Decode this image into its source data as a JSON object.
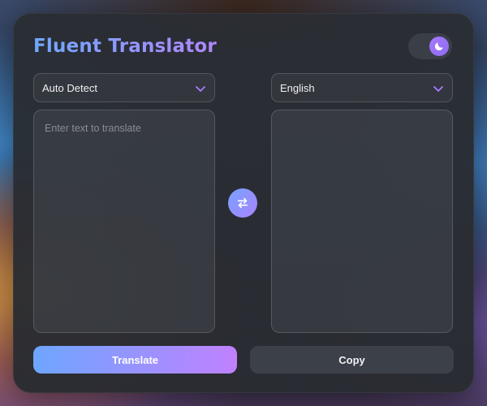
{
  "app": {
    "title": "Fluent Translator"
  },
  "theme_toggle": {
    "mode": "dark",
    "icon": "moon-icon"
  },
  "source": {
    "language": "Auto Detect",
    "text": "",
    "placeholder": "Enter text to translate"
  },
  "target": {
    "language": "English",
    "text": ""
  },
  "actions": {
    "translate_label": "Translate",
    "copy_label": "Copy",
    "swap_icon": "swap-arrows-icon"
  },
  "colors": {
    "accent_start": "#6ea6ff",
    "accent_end": "#c081ff",
    "panel": "#2a2d33"
  }
}
